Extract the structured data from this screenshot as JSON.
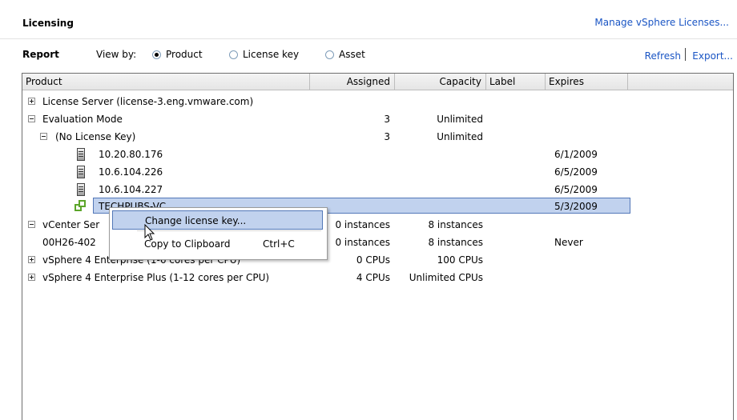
{
  "header": {
    "title": "Licensing",
    "manage_link": "Manage vSphere Licenses..."
  },
  "report": {
    "title": "Report",
    "view_by_label": "View by:",
    "options": [
      {
        "label": "Product",
        "selected": true
      },
      {
        "label": "License key",
        "selected": false
      },
      {
        "label": "Asset",
        "selected": false
      }
    ],
    "refresh": "Refresh",
    "export": "Export..."
  },
  "table": {
    "columns": [
      "Product",
      "Assigned",
      "Capacity",
      "Label",
      "Expires",
      ""
    ],
    "rows": [
      {
        "product": "License Server (license-3.eng.vmware.com)",
        "assigned": "",
        "capacity": "",
        "label": "",
        "expires": "",
        "toggle": "plus",
        "icon": "none"
      },
      {
        "product": "Evaluation Mode",
        "assigned": "3",
        "capacity": "Unlimited",
        "label": "",
        "expires": "",
        "toggle": "minus",
        "icon": "none"
      },
      {
        "product": "(No License Key)",
        "assigned": "3",
        "capacity": "Unlimited",
        "label": "",
        "expires": "",
        "toggle": "minus",
        "icon": "none"
      },
      {
        "product": "10.20.80.176",
        "assigned": "",
        "capacity": "",
        "label": "",
        "expires": "6/1/2009",
        "toggle": "none",
        "icon": "host-icon"
      },
      {
        "product": "10.6.104.226",
        "assigned": "",
        "capacity": "",
        "label": "",
        "expires": "6/5/2009",
        "toggle": "none",
        "icon": "host-icon"
      },
      {
        "product": "10.6.104.227",
        "assigned": "",
        "capacity": "",
        "label": "",
        "expires": "6/5/2009",
        "toggle": "none",
        "icon": "host-icon"
      },
      {
        "product": "TECHPUBS-VC",
        "assigned": "",
        "capacity": "",
        "label": "",
        "expires": "5/3/2009",
        "toggle": "none",
        "icon": "vcenter-icon"
      },
      {
        "product": "vCenter Ser",
        "assigned": "0 instances",
        "capacity": "8 instances",
        "label": "",
        "expires": "",
        "toggle": "minus",
        "icon": "none"
      },
      {
        "product": "00H26-402",
        "assigned": "0 instances",
        "capacity": "8 instances",
        "label": "",
        "expires": "Never",
        "toggle": "none",
        "icon": "none"
      },
      {
        "product": "vSphere 4 Enterprise (1-6 cores per CPU)",
        "assigned": "0 CPUs",
        "capacity": "100 CPUs",
        "label": "",
        "expires": "",
        "toggle": "plus",
        "icon": "none"
      },
      {
        "product": "vSphere 4 Enterprise Plus (1-12 cores per CPU)",
        "assigned": "4 CPUs",
        "capacity": "Unlimited CPUs",
        "label": "",
        "expires": "",
        "toggle": "plus",
        "icon": "none"
      }
    ]
  },
  "context_menu": {
    "items": [
      {
        "label": "Change license key...",
        "shortcut": "",
        "highlighted": true
      },
      {
        "label": "Copy to Clipboard",
        "shortcut": "Ctrl+C",
        "highlighted": false
      }
    ]
  },
  "colors": {
    "link": "#1a55c4",
    "selection": "#c1d2ee",
    "selection_border": "#5378b8",
    "vcenter_icon": "#5ca52a"
  }
}
